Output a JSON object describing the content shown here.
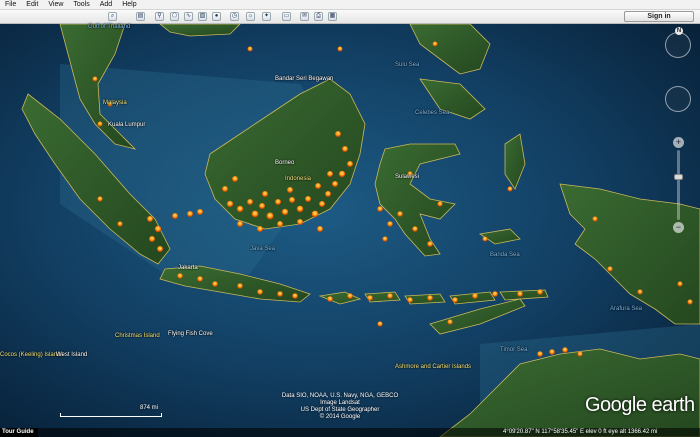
{
  "menu": [
    "File",
    "Edit",
    "View",
    "Tools",
    "Add",
    "Help"
  ],
  "toolbar": {
    "signin": "Sign in",
    "buttons": [
      "search",
      "sidebar",
      "placemark",
      "polygon",
      "path",
      "overlay",
      "tour",
      "historical-imagery",
      "sun",
      "sky",
      "ruler",
      "email",
      "print",
      "view-in-maps"
    ]
  },
  "map_labels": [
    {
      "text": "Gulf of Thailand",
      "cls": "b"
    },
    {
      "text": "Bandar Seri Begawan",
      "cls": "w"
    },
    {
      "text": "Kuala Lumpur",
      "cls": "w"
    },
    {
      "text": "Malaysia",
      "cls": "y"
    },
    {
      "text": "Sulu Sea",
      "cls": "b"
    },
    {
      "text": "Celebes Sea",
      "cls": "b"
    },
    {
      "text": "Borneo",
      "cls": "w"
    },
    {
      "text": "Indonesia",
      "cls": "y"
    },
    {
      "text": "Sulawesi",
      "cls": "w"
    },
    {
      "text": "Java Sea",
      "cls": "b"
    },
    {
      "text": "Banda Sea",
      "cls": "b"
    },
    {
      "text": "Jakarta",
      "cls": "w"
    },
    {
      "text": "Arafura Sea",
      "cls": "b"
    },
    {
      "text": "Timor Sea",
      "cls": "b"
    },
    {
      "text": "Christmas Island",
      "cls": "y"
    },
    {
      "text": "Flying Fish Cove",
      "cls": "w"
    },
    {
      "text": "Cocos (Keeling) Islands",
      "cls": "y"
    },
    {
      "text": "West Island",
      "cls": "w"
    },
    {
      "text": "Ashmore and Cartier Islands",
      "cls": "y"
    }
  ],
  "attribution": [
    "Data SIO, NOAA, U.S. Navy, NGA, GEBCO",
    "Image Landsat",
    "US Dept of State Geographer",
    "© 2014 Google"
  ],
  "logo": "Google earth",
  "scale_label": "874 mi",
  "tour_guide": "Tour Guide",
  "status": "4°09'20.87\" N  117°58'35.45\" E  elev  0 ft  eye alt  1366.42 mi",
  "nav": {
    "north": "N"
  },
  "colors": {
    "ocean": "#0e3a5e",
    "land": "#2f5a2a",
    "fire": "#ff8a00"
  }
}
